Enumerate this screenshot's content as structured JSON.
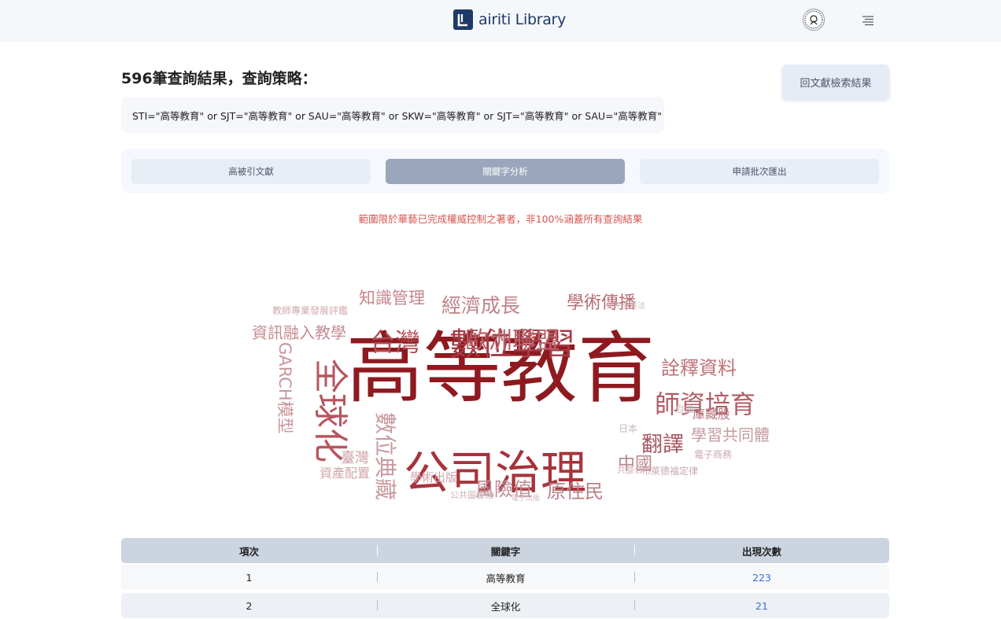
{
  "header": {
    "logo_text": "airiti Library",
    "brand_color": "#1f3a68",
    "avatar_icon": "seal-avatar-icon",
    "menu_icon": "hamburger-menu-icon"
  },
  "results": {
    "title": "596筆查詢結果，查詢策略：",
    "strategy": "STI=\"高等教育\" or SJT=\"高等教育\" or SAU=\"高等教育\" or SKW=\"高等教育\" or SJT=\"高等教育\" or SAU=\"高等教育\"",
    "back_button": "回文獻檢索結果"
  },
  "tabs": [
    {
      "label": "高被引文獻",
      "active": false
    },
    {
      "label": "關鍵字分析",
      "active": true
    },
    {
      "label": "申請批次匯出",
      "active": false
    }
  ],
  "notice": "範圍限於華藝已完成權威控制之著者，非100%涵蓋所有查詢結果",
  "notice_color": "#d9534f",
  "word_cloud": [
    {
      "text": "高等教育"
    },
    {
      "text": "公司治理"
    },
    {
      "text": "數位學習"
    },
    {
      "text": "全球化"
    },
    {
      "text": "台灣"
    },
    {
      "text": "歐洲聯盟"
    },
    {
      "text": "經濟成長"
    },
    {
      "text": "學術傳播"
    },
    {
      "text": "知識管理"
    },
    {
      "text": "資訊融入教學"
    },
    {
      "text": "詮釋資料"
    },
    {
      "text": "師資培育"
    },
    {
      "text": "翻譯"
    },
    {
      "text": "學習共同體"
    },
    {
      "text": "中國"
    },
    {
      "text": "原住民"
    },
    {
      "text": "風險值"
    },
    {
      "text": "數位典藏"
    },
    {
      "text": "GARCH模型"
    },
    {
      "text": "臺灣"
    },
    {
      "text": "資產配置"
    },
    {
      "text": "學術出版"
    },
    {
      "text": "庫藏股"
    },
    {
      "text": "電子商務"
    },
    {
      "text": "布萊德福定律"
    },
    {
      "text": "公共圖書館"
    },
    {
      "text": "教師專業發展評鑑"
    },
    {
      "text": "日本"
    },
    {
      "text": "自由"
    },
    {
      "text": "共整合"
    },
    {
      "text": "電子出版"
    },
    {
      "text": "公平交易法"
    }
  ],
  "table": {
    "headers": [
      "項次",
      "關鍵字",
      "出現次數"
    ],
    "rows": [
      {
        "index": "1",
        "keyword": "高等教育",
        "count": "223"
      },
      {
        "index": "2",
        "keyword": "全球化",
        "count": "21"
      }
    ]
  }
}
